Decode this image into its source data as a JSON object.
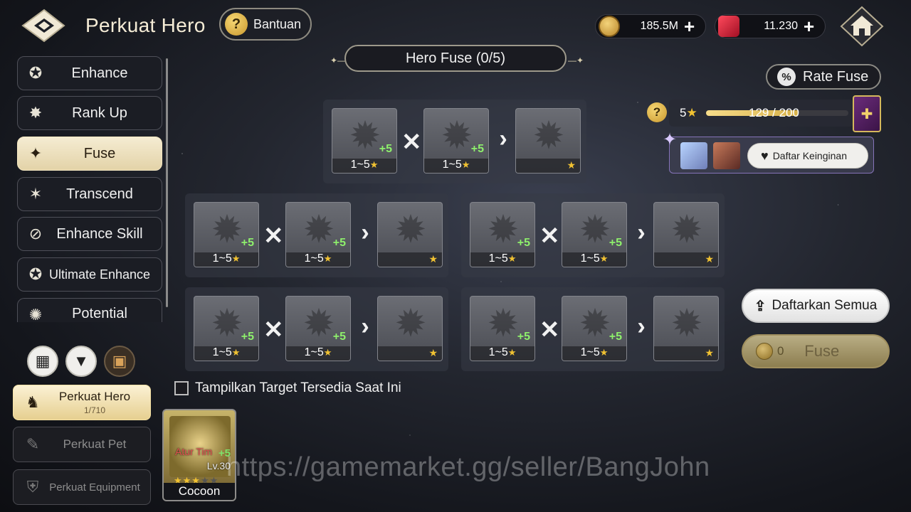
{
  "header": {
    "title": "Perkuat Hero",
    "help_label": "Bantuan",
    "gold": "185.5M",
    "gems": "11.230"
  },
  "sidebar": {
    "tabs": [
      {
        "label": "Enhance",
        "icon": "enhance-icon"
      },
      {
        "label": "Rank Up",
        "icon": "rank-up-icon"
      },
      {
        "label": "Fuse",
        "icon": "fuse-icon",
        "active": true
      },
      {
        "label": "Transcend",
        "icon": "transcend-icon"
      },
      {
        "label": "Enhance Skill",
        "icon": "skill-icon"
      },
      {
        "label": "Ultimate Enhance",
        "icon": "ultimate-icon"
      },
      {
        "label": "Potential",
        "icon": "potential-icon"
      }
    ],
    "categories": [
      {
        "label": "Perkuat Hero",
        "sub": "1/710",
        "active": true
      },
      {
        "label": "Perkuat Pet"
      },
      {
        "label": "Perkuat Equipment"
      }
    ]
  },
  "fuse": {
    "banner": "Hero Fuse (0/5)",
    "rate_label": "Rate Fuse",
    "slot_level": "1~5",
    "slot_plus": "+5",
    "groups": 5
  },
  "selection": {
    "stars": "5",
    "progress_text": "129 / 200",
    "progress_fraction": 0.645,
    "wishlist_label": "Daftar Keinginan"
  },
  "actions": {
    "register_all": "Daftarkan Semua",
    "fuse_cost": "0",
    "fuse_label": "Fuse"
  },
  "filter": {
    "show_available": "Tampilkan Target Tersedia Saat Ini"
  },
  "hero_card": {
    "tag": "Atur Tim",
    "plus": "+5",
    "level": "Lv.30",
    "name": "Cocoon"
  },
  "watermark": "https://gamemarket.gg/seller/BangJohn",
  "colors": {
    "accent_gold": "#e6cf90",
    "green_plus": "#8ef06c",
    "star": "#f1c232"
  }
}
